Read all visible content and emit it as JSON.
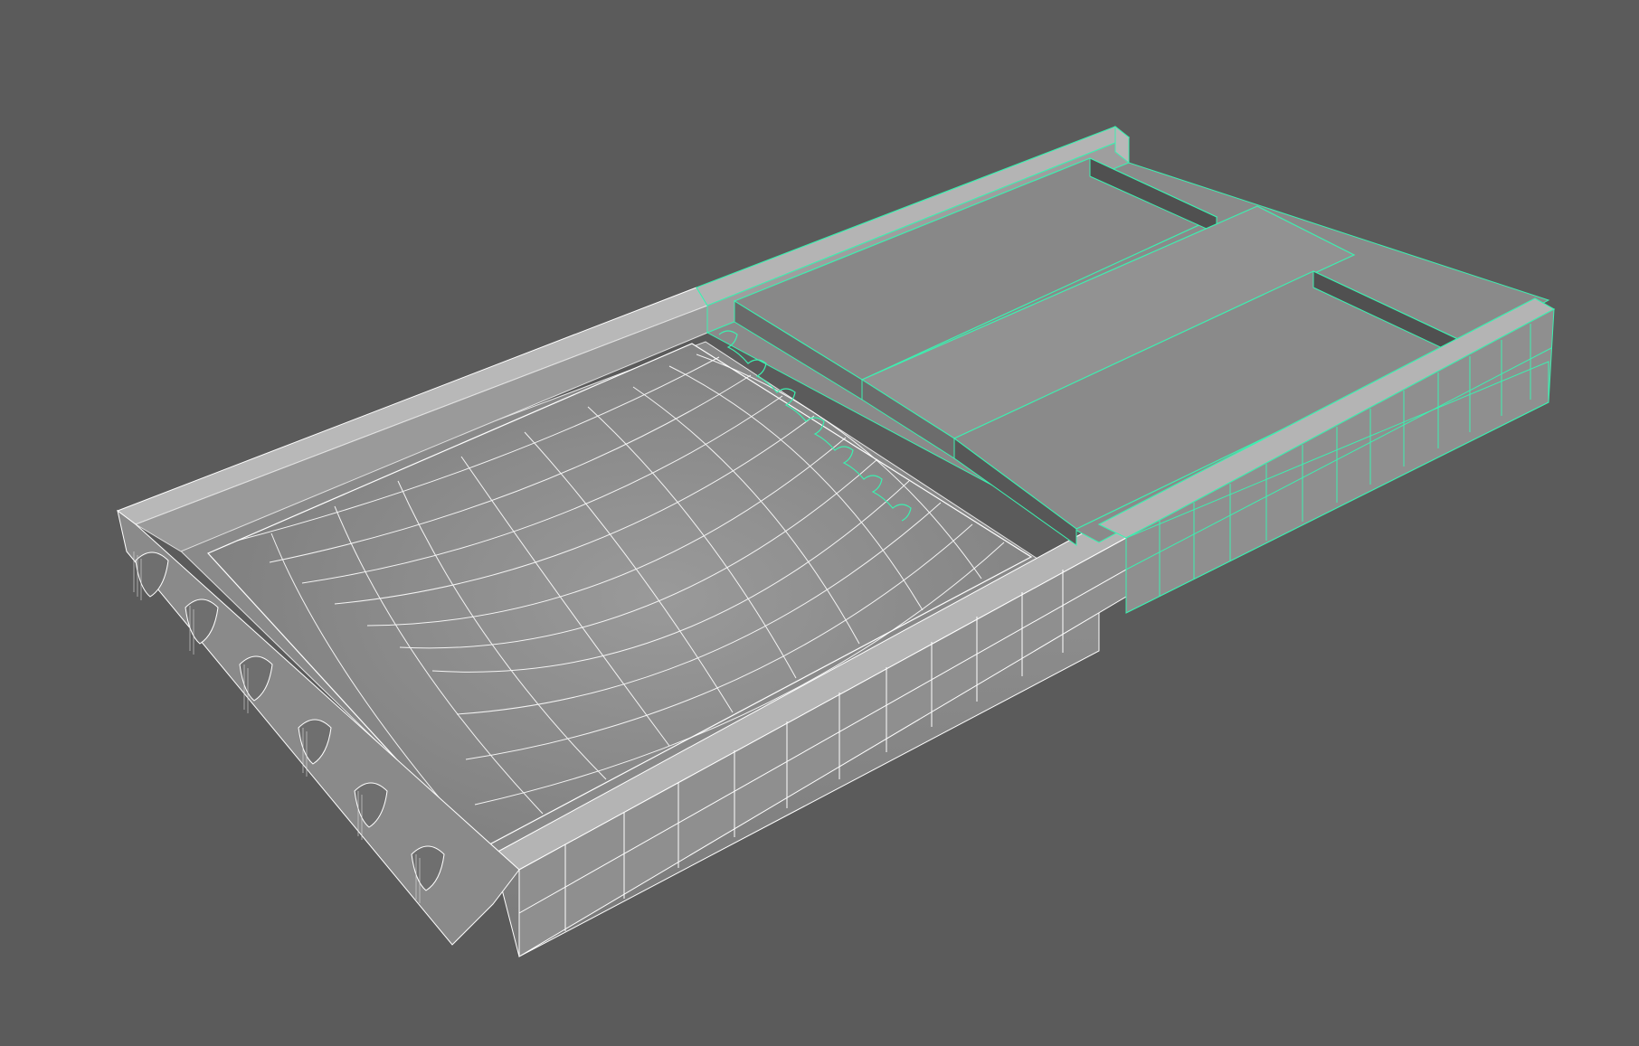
{
  "viewport": {
    "background": "#5b5b5b",
    "shading": "smooth-shade-with-wireframe"
  },
  "model": {
    "base_color": "#8c8c8c",
    "wire_color": "#ffffff",
    "selection_color": "#3cf0b0",
    "selected_component": "right-section",
    "tray_sections": 2
  }
}
